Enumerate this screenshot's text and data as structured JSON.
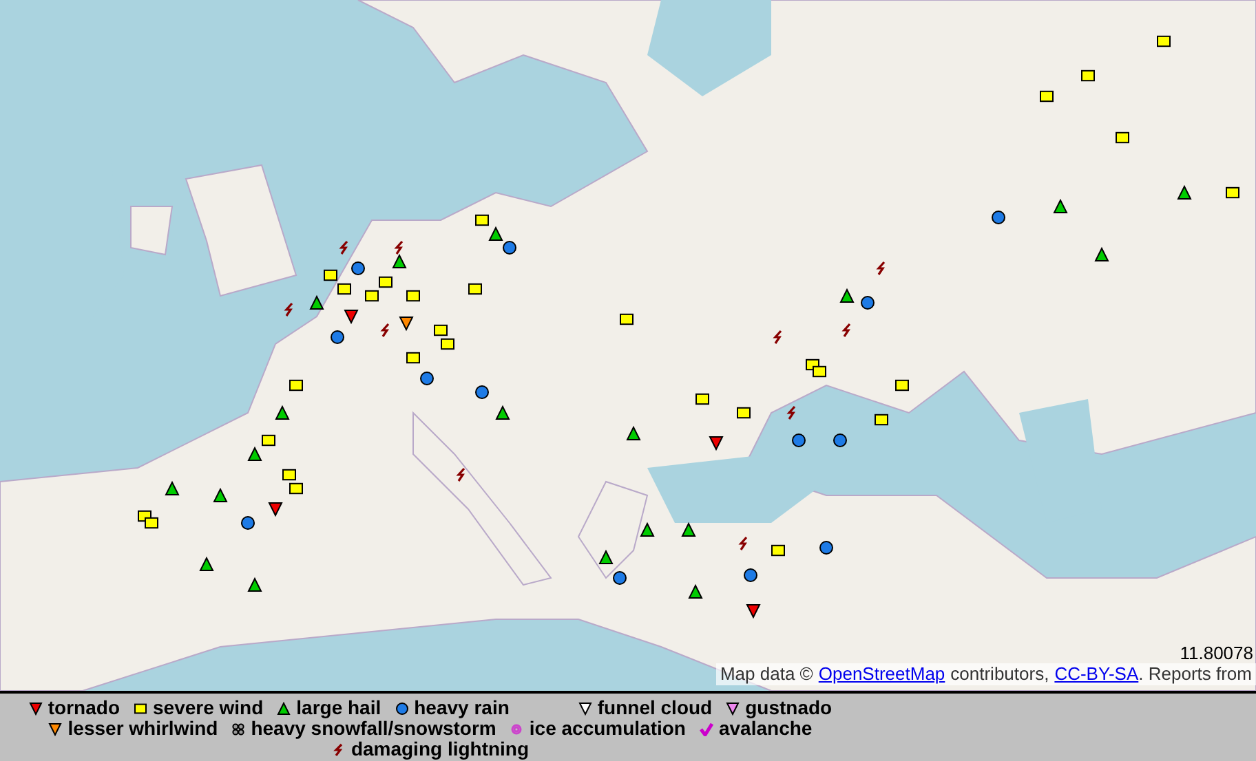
{
  "map": {
    "coordinate": "11.80078",
    "attribution": {
      "prefix": "Map data ©",
      "link_1": "OpenStreetMap",
      "middle": "contributors,",
      "link_2": "CC-BY-SA",
      "suffix": ". Reports from"
    }
  },
  "legend": [
    {
      "kind": "tornado",
      "label": "tornado",
      "color": "#ee0000"
    },
    {
      "kind": "wind",
      "label": "severe wind",
      "color": "#ffff00"
    },
    {
      "kind": "hail",
      "label": "large hail",
      "color": "#00cc00"
    },
    {
      "kind": "rain",
      "label": "heavy rain",
      "color": "#1e7be6"
    },
    {
      "kind": "tornado",
      "label": "funnel cloud",
      "color": "#ffffff"
    },
    {
      "kind": "tornado",
      "label": "gustnado",
      "color": "#ee88ee"
    },
    {
      "kind": "tornado",
      "label": "lesser whirlwind",
      "color": "#ff8800"
    },
    {
      "kind": "snow",
      "label": "heavy snowfall/snowstorm",
      "color": "#999999"
    },
    {
      "kind": "ice",
      "label": "ice accumulation",
      "color": "#cc44cc"
    },
    {
      "kind": "avalanche",
      "label": "avalanche",
      "color": "#cc00cc"
    },
    {
      "kind": "lightning",
      "label": "damaging lightning",
      "color": "#880000"
    }
  ]
}
